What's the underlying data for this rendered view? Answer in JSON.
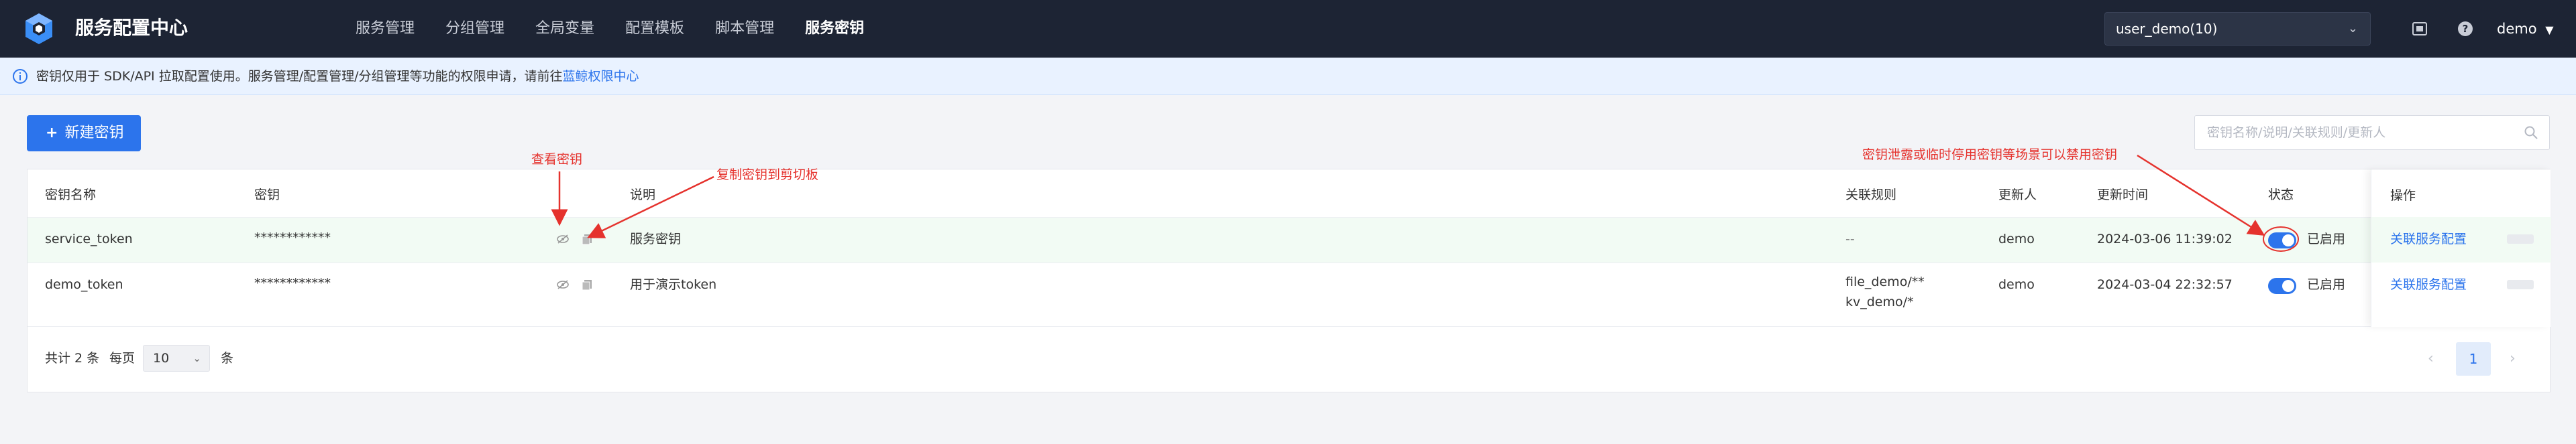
{
  "header": {
    "app_title": "服务配置中心",
    "nav": [
      {
        "label": "服务管理"
      },
      {
        "label": "分组管理"
      },
      {
        "label": "全局变量"
      },
      {
        "label": "配置模板"
      },
      {
        "label": "脚本管理"
      },
      {
        "label": "服务密钥",
        "active": true
      }
    ],
    "tenant": "user_demo(10)",
    "user": "demo"
  },
  "notice": {
    "text": "密钥仅用于 SDK/API 拉取配置使用。服务管理/配置管理/分组管理等功能的权限申请，请前往",
    "link": "蓝鲸权限中心"
  },
  "toolbar": {
    "new_button": "新建密钥",
    "search_placeholder": "密钥名称/说明/关联规则/更新人"
  },
  "table": {
    "columns": {
      "name": "密钥名称",
      "secret": "密钥",
      "desc": "说明",
      "rules": "关联规则",
      "updater": "更新人",
      "updated_at": "更新时间",
      "status": "状态",
      "ops": "操作"
    },
    "rows": [
      {
        "name": "service_token",
        "secret": "************",
        "desc": "服务密钥",
        "rules": [
          "--"
        ],
        "updater": "demo",
        "updated_at": "2024-03-06 11:39:02",
        "status": "已启用",
        "op": "关联服务配置"
      },
      {
        "name": "demo_token",
        "secret": "************",
        "desc": "用于演示token",
        "rules": [
          "file_demo/**",
          "kv_demo/*"
        ],
        "updater": "demo",
        "updated_at": "2024-03-04 22:32:57",
        "status": "已启用",
        "op": "关联服务配置"
      }
    ]
  },
  "pagination": {
    "total": "共计 2 条",
    "per_page_label": "每页",
    "page_size": "10",
    "unit": "条",
    "current": "1"
  },
  "annotations": {
    "view_secret": "查看密钥",
    "copy_secret": "复制密钥到剪切板",
    "disable_hint": "密钥泄露或临时停用密钥等场景可以禁用密钥"
  },
  "colors": {
    "header_bg": "#1d2434",
    "primary": "#2c74ec",
    "annotation": "#e5322d",
    "highlight_row": "#f2fbf4"
  },
  "icons": {
    "logo": "cube-logo-icon",
    "view": "eye-slash-icon",
    "copy": "copy-icon",
    "search": "search-icon",
    "info": "info-icon"
  }
}
